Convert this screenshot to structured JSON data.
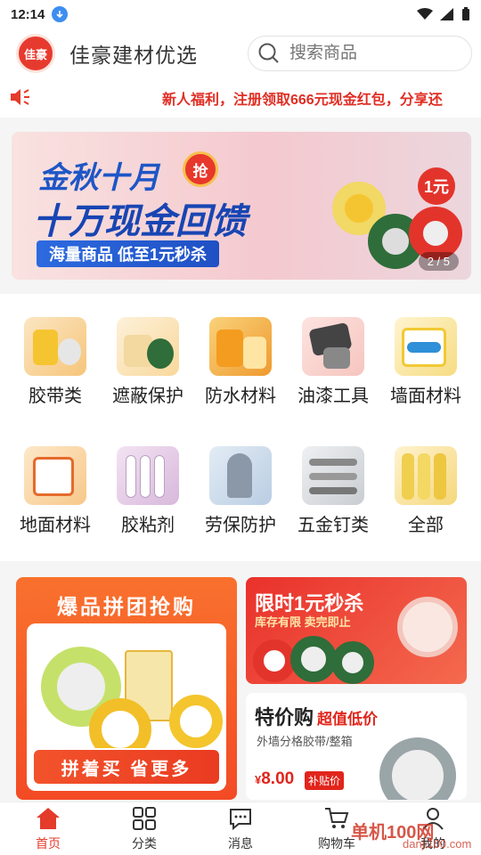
{
  "status": {
    "time": "12:14"
  },
  "header": {
    "logo_text": "佳豪",
    "title": "佳豪建材优选",
    "search_placeholder": "搜索商品"
  },
  "notice": {
    "text": "新人福利，注册领取666元现金红包，分享还"
  },
  "banner": {
    "title_line1": "金秋十月",
    "title_line2": "十万现金回馈",
    "badge": "抢",
    "pill": "海量商品 低至1元秒杀",
    "price_badge": "1元",
    "counter": "2 / 5"
  },
  "categories": [
    {
      "label": "胶带类",
      "icon": "tape-icon"
    },
    {
      "label": "遮蔽保护",
      "icon": "masking-icon"
    },
    {
      "label": "防水材料",
      "icon": "waterproof-icon"
    },
    {
      "label": "油漆工具",
      "icon": "paint-tool-icon"
    },
    {
      "label": "墙面材料",
      "icon": "wall-icon"
    },
    {
      "label": "地面材料",
      "icon": "floor-icon"
    },
    {
      "label": "胶粘剂",
      "icon": "adhesive-icon"
    },
    {
      "label": "劳保防护",
      "icon": "protection-icon"
    },
    {
      "label": "五金钉类",
      "icon": "hardware-icon"
    },
    {
      "label": "全部",
      "icon": "all-icon"
    }
  ],
  "promo_left": {
    "title": "爆品拼团抢购",
    "button": "拼着买 省更多"
  },
  "promo_right_top": {
    "title": "限时1元秒杀",
    "subtitle": "库存有限 卖完即止"
  },
  "promo_right_bottom": {
    "title": "特价购",
    "title_tag": "超值低价",
    "subtitle": "外墙分格胶带/整箱",
    "price": "8.00",
    "currency": "¥",
    "tag": "补贴价"
  },
  "tabbar": [
    {
      "label": "首页",
      "icon": "home-icon",
      "active": true
    },
    {
      "label": "分类",
      "icon": "grid-icon",
      "active": false
    },
    {
      "label": "消息",
      "icon": "message-icon",
      "active": false
    },
    {
      "label": "购物车",
      "icon": "cart-icon",
      "active": false
    },
    {
      "label": "我的",
      "icon": "user-icon",
      "active": false
    }
  ],
  "watermark": {
    "text": "单机100网",
    "sub": "danji100.com"
  },
  "colors": {
    "accent": "#e53b2b",
    "banner_blue": "#1e56c6",
    "promo_orange": "#f5592a"
  }
}
